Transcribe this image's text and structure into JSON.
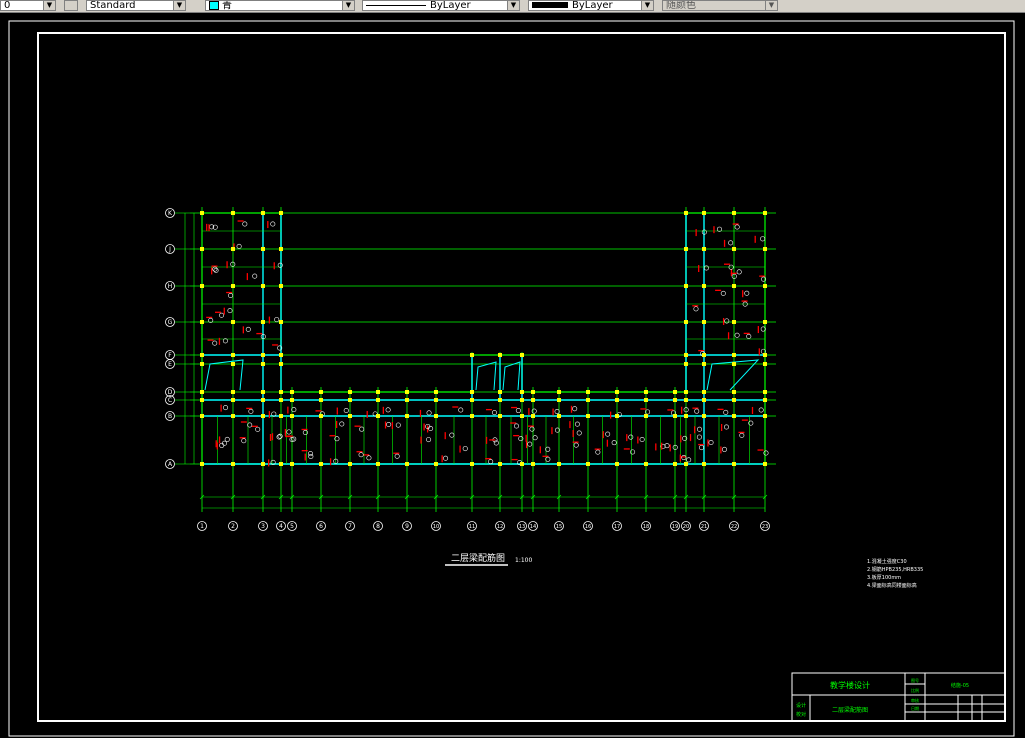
{
  "toolbar": {
    "layer_value": "0",
    "textstyle_value": "Standard",
    "color_value": "青",
    "linetype_value": "ByLayer",
    "lineweight_value": "ByLayer",
    "plotstyle_value": "随颜色"
  },
  "drawing": {
    "title": "二层梁配筋图",
    "scale": "1:100",
    "axes_rows": [
      "K",
      "J",
      "H",
      "G",
      "F",
      "E",
      "D",
      "C",
      "B",
      "A"
    ],
    "axes_cols": [
      "1",
      "2",
      "3",
      "4",
      "5",
      "6",
      "7",
      "8",
      "9",
      "10",
      "11",
      "12",
      "13",
      "14",
      "15",
      "16",
      "17",
      "18",
      "19",
      "20",
      "21",
      "22",
      "23"
    ],
    "notes": [
      "1.混凝土强度C30",
      "2.钢筋HPB235,HRB335",
      "3.板厚100mm",
      "4.梁面标高同楼面标高"
    ],
    "titleblock": {
      "project": "教学楼设计",
      "drawing_name": "二层梁配筋图",
      "code": "结施-05",
      "label_a": "图号",
      "label_b": "比例",
      "label_c": "日期",
      "label_d": "设计",
      "label_e": "校对",
      "label_f": "审核"
    }
  },
  "colors": {
    "bg": "#000000",
    "green": "#00ff00",
    "cyan": "#00ffff",
    "yellow": "#ffff00",
    "red": "#ff0000",
    "white": "#ffffff"
  }
}
